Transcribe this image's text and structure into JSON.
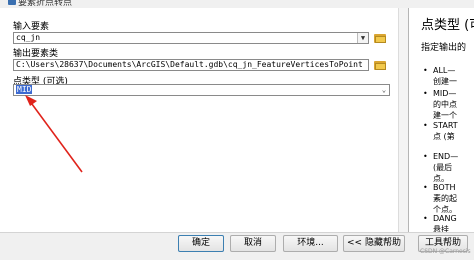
{
  "window": {
    "title": "要素折点转点"
  },
  "form": {
    "input_label": "输入要素",
    "input_value": "cq_jn",
    "output_label": "输出要素类",
    "output_value": "C:\\Users\\28637\\Documents\\ArcGIS\\Default.gdb\\cq_jn_FeatureVerticesToPoint",
    "point_type_label": "点类型 (可选)",
    "point_type_value": "MID"
  },
  "help": {
    "title": "点类型 (可",
    "description": "指定输出的",
    "items": [
      {
        "line1": "ALL—",
        "line2": "创建一"
      },
      {
        "line1": "MID—",
        "line2": "的中点",
        "line3": "建一个"
      },
      {
        "line1": "START",
        "line2": "点 (第"
      },
      {
        "line1": "END—",
        "line2": "(最后",
        "line3": "点。"
      },
      {
        "line1": "BOTH",
        "line2": "素的起",
        "line3": "个点。"
      },
      {
        "line1": "DANG",
        "line2": "悬挂"
      }
    ]
  },
  "buttons": {
    "ok": "确定",
    "cancel": "取消",
    "environments": "环境...",
    "hide_help": "<< 隐藏帮助",
    "tool_help": "工具帮助"
  },
  "watermark": "CSDN @Carnesis",
  "colors": {
    "selection": "#3c6ad1",
    "arrow": "#e0231b"
  }
}
